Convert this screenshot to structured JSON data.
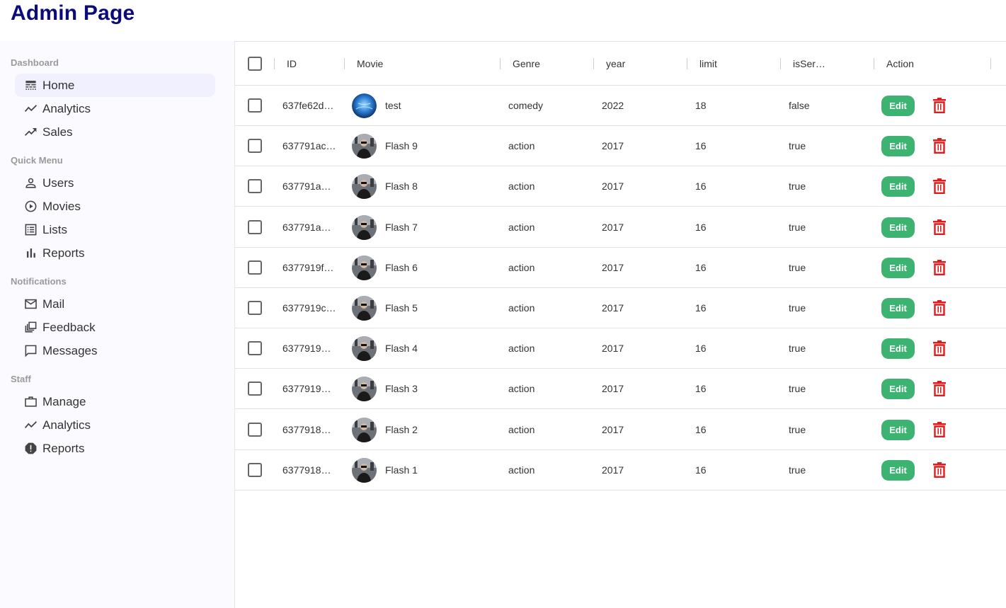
{
  "app": {
    "title": "Admin Page"
  },
  "sidebar": {
    "sections": [
      {
        "title": "Dashboard",
        "items": [
          {
            "label": "Home",
            "icon": "line-style-icon",
            "active": true
          },
          {
            "label": "Analytics",
            "icon": "timeline-icon"
          },
          {
            "label": "Sales",
            "icon": "trending-up-icon"
          }
        ]
      },
      {
        "title": "Quick Menu",
        "items": [
          {
            "label": "Users",
            "icon": "person-outline-icon"
          },
          {
            "label": "Movies",
            "icon": "play-circle-icon"
          },
          {
            "label": "Lists",
            "icon": "list-icon"
          },
          {
            "label": "Reports",
            "icon": "bar-chart-icon"
          }
        ]
      },
      {
        "title": "Notifications",
        "items": [
          {
            "label": "Mail",
            "icon": "mail-outline-icon"
          },
          {
            "label": "Feedback",
            "icon": "dynamic-feed-icon"
          },
          {
            "label": "Messages",
            "icon": "chat-bubble-outline-icon"
          }
        ]
      },
      {
        "title": "Staff",
        "items": [
          {
            "label": "Manage",
            "icon": "work-outline-icon"
          },
          {
            "label": "Analytics",
            "icon": "timeline-icon"
          },
          {
            "label": "Reports",
            "icon": "report-icon"
          }
        ]
      }
    ]
  },
  "table": {
    "columns": [
      "ID",
      "Movie",
      "Genre",
      "year",
      "limit",
      "isSer…",
      "Action"
    ],
    "edit_label": "Edit",
    "rows": [
      {
        "id": "637fe62d…",
        "movie": "test",
        "genre": "comedy",
        "year": "2022",
        "limit": "18",
        "isSeries": "false",
        "avatar": "globe"
      },
      {
        "id": "637791ac…",
        "movie": "Flash 9",
        "genre": "action",
        "year": "2017",
        "limit": "16",
        "isSeries": "true",
        "avatar": "person"
      },
      {
        "id": "637791a…",
        "movie": "Flash 8",
        "genre": "action",
        "year": "2017",
        "limit": "16",
        "isSeries": "true",
        "avatar": "person"
      },
      {
        "id": "637791a…",
        "movie": "Flash 7",
        "genre": "action",
        "year": "2017",
        "limit": "16",
        "isSeries": "true",
        "avatar": "person"
      },
      {
        "id": "6377919f…",
        "movie": "Flash 6",
        "genre": "action",
        "year": "2017",
        "limit": "16",
        "isSeries": "true",
        "avatar": "person"
      },
      {
        "id": "6377919c…",
        "movie": "Flash 5",
        "genre": "action",
        "year": "2017",
        "limit": "16",
        "isSeries": "true",
        "avatar": "person"
      },
      {
        "id": "6377919…",
        "movie": "Flash 4",
        "genre": "action",
        "year": "2017",
        "limit": "16",
        "isSeries": "true",
        "avatar": "person"
      },
      {
        "id": "6377919…",
        "movie": "Flash 3",
        "genre": "action",
        "year": "2017",
        "limit": "16",
        "isSeries": "true",
        "avatar": "person"
      },
      {
        "id": "6377918…",
        "movie": "Flash 2",
        "genre": "action",
        "year": "2017",
        "limit": "16",
        "isSeries": "true",
        "avatar": "person"
      },
      {
        "id": "6377918…",
        "movie": "Flash 1",
        "genre": "action",
        "year": "2017",
        "limit": "16",
        "isSeries": "true",
        "avatar": "person"
      }
    ]
  },
  "colors": {
    "brand": "#0b0b7a",
    "edit": "#3cb371",
    "delete": "#e01b1b",
    "active_bg": "#f0f0ff"
  }
}
